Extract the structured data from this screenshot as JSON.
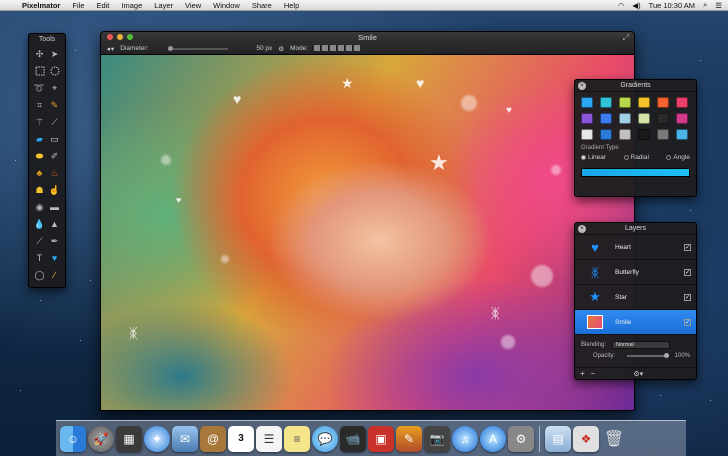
{
  "menubar": {
    "app": "Pixelmator",
    "items": [
      "File",
      "Edit",
      "Image",
      "Layer",
      "View",
      "Window",
      "Share",
      "Help"
    ],
    "clock": "Tue 10:30 AM"
  },
  "tools": {
    "title": "Tools",
    "items": [
      "move",
      "selection",
      "rect-marquee",
      "ellipse-marquee",
      "lasso",
      "polygonal-lasso",
      "crop",
      "eyedropper",
      "magic-wand",
      "paint-bucket",
      "eraser",
      "brush",
      "pencil",
      "clone-stamp",
      "smudge",
      "sharpen",
      "blur",
      "dodge",
      "burn",
      "sponge",
      "red-eye",
      "healing",
      "gradient",
      "pen",
      "text",
      "shape",
      "zoom",
      "color"
    ]
  },
  "window": {
    "title": "Smile",
    "options": {
      "diameter_label": "Diameter:",
      "diameter_value": "50 px",
      "mode_label": "Mode:"
    }
  },
  "gradients": {
    "title": "Gradients",
    "swatches": [
      "#2aa7f0",
      "#31c4d8",
      "#b9d84a",
      "#f4c22a",
      "#f2612e",
      "#ea3f6a",
      "#8a55d8",
      "#3b7cf0",
      "#9fd0e6",
      "#d4e4a8",
      "#2a2a2a",
      "#d23a8a",
      "#e6e6e6",
      "#2a7ad8",
      "#c0c0c0",
      "#1a1a1a",
      "#7a7a7a",
      "#4ab4e8"
    ],
    "type_label": "Gradient Type",
    "types": [
      "Linear",
      "Radial",
      "Angle"
    ],
    "selected_type": "Linear"
  },
  "layers": {
    "title": "Layers",
    "items": [
      {
        "name": "Heart",
        "icon": "heart",
        "selected": false
      },
      {
        "name": "Butterfly",
        "icon": "butterfly",
        "selected": false
      },
      {
        "name": "Star",
        "icon": "star",
        "selected": false
      },
      {
        "name": "Smile",
        "icon": "photo",
        "selected": true
      }
    ],
    "blending_label": "Blending:",
    "blending_value": "Normal",
    "opacity_label": "Opacity:",
    "opacity_value": "100%"
  },
  "dock": {
    "apps": [
      "Finder",
      "Launchpad",
      "Mission Control",
      "Safari",
      "Mail",
      "Contacts",
      "Calendar",
      "Reminders",
      "Notes",
      "Messages",
      "FaceTime",
      "Photo Booth",
      "Pixelmator",
      "Photos",
      "iTunes",
      "App Store",
      "System Preferences"
    ],
    "calendar_day": "3",
    "right": [
      "Documents",
      "Downloads",
      "Trash"
    ]
  }
}
